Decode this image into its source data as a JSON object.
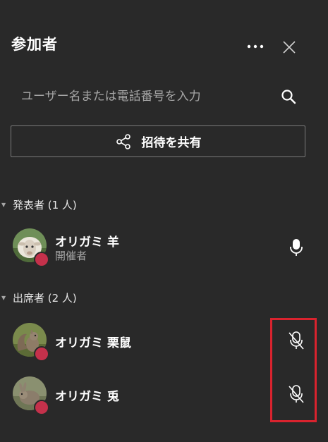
{
  "header": {
    "title": "参加者"
  },
  "search": {
    "placeholder": "ユーザー名または電話番号を入力"
  },
  "share": {
    "label": "招待を共有"
  },
  "sections": [
    {
      "label": "発表者 (1 人)",
      "people": [
        {
          "name": "オリガミ 羊",
          "role": "開催者",
          "mic": "on",
          "status": "busy"
        }
      ]
    },
    {
      "label": "出席者 (2 人)",
      "people": [
        {
          "name": "オリガミ 栗鼠",
          "mic": "muted",
          "status": "busy"
        },
        {
          "name": "オリガミ 兎",
          "mic": "muted",
          "status": "busy"
        }
      ]
    }
  ],
  "colors": {
    "background": "#292929",
    "status_busy": "#c4314b",
    "highlight": "#d9232e"
  },
  "icons": {
    "more": "more-options-icon",
    "close": "close-icon",
    "search": "search-icon",
    "share": "share-icon",
    "mic_on": "microphone-icon",
    "mic_muted": "microphone-muted-icon"
  }
}
